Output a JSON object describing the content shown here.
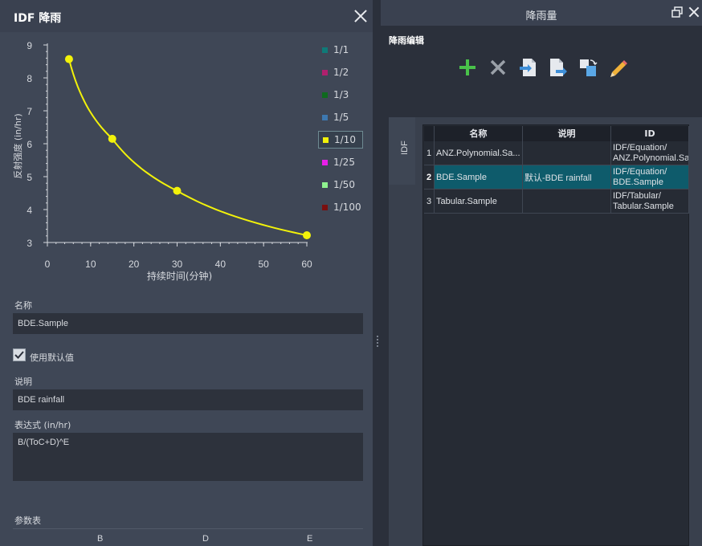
{
  "left_panel": {
    "title": "IDF 降雨",
    "name_label": "名称",
    "name_value": "BDE.Sample",
    "use_default_label": "使用默认值",
    "use_default_checked": true,
    "description_label": "说明",
    "description_value": "BDE rainfall",
    "expression_label": "表达式 (in/hr)",
    "expression_value": "B/(ToC+D)^E",
    "param_table_label": "参数表",
    "param_columns": [
      "B",
      "D",
      "E"
    ]
  },
  "chart_data": {
    "type": "line",
    "xlabel": "持续时间(分钟)",
    "ylabel": "反射强度 (in/hr)",
    "xlim": [
      0,
      60
    ],
    "ylim": [
      3,
      9
    ],
    "xticks": [
      0,
      10,
      20,
      30,
      40,
      50,
      60
    ],
    "yticks": [
      3,
      4,
      5,
      6,
      7,
      8,
      9
    ],
    "grid": false,
    "legend_placement": "right",
    "legend": [
      {
        "label": "1/1",
        "color": "#0f7a78"
      },
      {
        "label": "1/2",
        "color": "#b0206e"
      },
      {
        "label": "1/3",
        "color": "#0f6a1e"
      },
      {
        "label": "1/5",
        "color": "#3d78b0"
      },
      {
        "label": "1/10",
        "color": "#f2f20a",
        "selected": true
      },
      {
        "label": "1/25",
        "color": "#e81fe8"
      },
      {
        "label": "1/50",
        "color": "#8ff28f"
      },
      {
        "label": "1/100",
        "color": "#7a0f0f"
      }
    ],
    "series": [
      {
        "legend_label": "1/10",
        "color": "#f2f20a",
        "points": [
          {
            "x": 5,
            "y": 8.57
          },
          {
            "x": 15,
            "y": 6.15
          },
          {
            "x": 30,
            "y": 4.57
          },
          {
            "x": 60,
            "y": 3.22
          }
        ]
      }
    ]
  },
  "right_panel": {
    "title": "降雨量",
    "section_title": "降雨编辑",
    "toolbar": [
      {
        "name": "add-icon"
      },
      {
        "name": "delete-icon"
      },
      {
        "name": "import-icon"
      },
      {
        "name": "export-icon"
      },
      {
        "name": "copy-icon"
      },
      {
        "name": "edit-icon"
      }
    ],
    "tab_label": "IDF",
    "grid_headers": [
      "名称",
      "说明",
      "ID"
    ],
    "rows": [
      {
        "n": "1",
        "name": "ANZ.Polynomial.Sa...",
        "desc": "",
        "id": "IDF/Equation/\nANZ.Polynomial.Sa..."
      },
      {
        "n": "2",
        "name": "BDE.Sample",
        "desc": "默认-BDE rainfall",
        "id": "IDF/Equation/\nBDE.Sample",
        "selected": true
      },
      {
        "n": "3",
        "name": "Tabular.Sample",
        "desc": "",
        "id": "IDF/Tabular/\nTabular.Sample"
      }
    ]
  }
}
